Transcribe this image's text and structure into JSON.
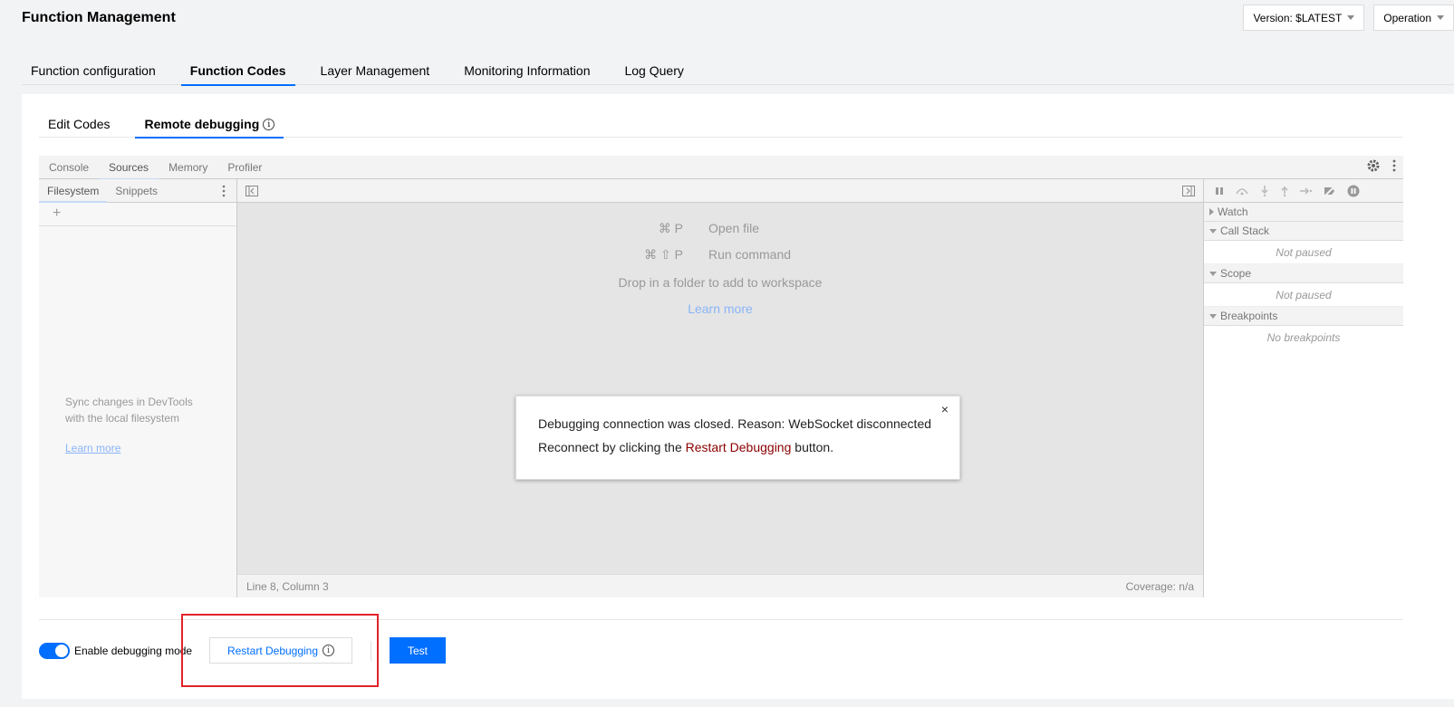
{
  "header": {
    "title": "Function Management",
    "version_label": "Version: $LATEST",
    "operation_label": "Operation"
  },
  "main_tabs": [
    {
      "label": "Function configuration"
    },
    {
      "label": "Function Codes",
      "active": true
    },
    {
      "label": "Layer Management"
    },
    {
      "label": "Monitoring Information"
    },
    {
      "label": "Log Query"
    }
  ],
  "sub_tabs": [
    {
      "label": "Edit Codes"
    },
    {
      "label": "Remote debugging",
      "active": true
    }
  ],
  "devtools": {
    "tabs": [
      "Console",
      "Sources",
      "Memory",
      "Profiler"
    ],
    "left_tabs": [
      "Filesystem",
      "Snippets"
    ],
    "plus": "+",
    "sync_msg": "Sync changes in DevTools with the local filesystem",
    "learn_more": "Learn more",
    "shortcuts": [
      {
        "key": "⌘ P",
        "action": "Open file"
      },
      {
        "key": "⌘ ⇧ P",
        "action": "Run command"
      }
    ],
    "drop_msg": "Drop in a folder to add to workspace",
    "learn_more_center": "Learn more",
    "status_left": "Line 8, Column 3",
    "status_right": "Coverage: n/a",
    "sections": {
      "watch": "Watch",
      "call_stack": "Call Stack",
      "call_stack_empty": "Not paused",
      "scope": "Scope",
      "scope_empty": "Not paused",
      "breakpoints": "Breakpoints",
      "breakpoints_empty": "No breakpoints"
    }
  },
  "dialog": {
    "close": "×",
    "line1": "Debugging connection was closed. Reason: WebSocket disconnected",
    "line2_pre": "Reconnect by clicking the ",
    "line2_link": "Restart Debugging",
    "line2_post": " button."
  },
  "footer": {
    "toggle_label": "Enable debugging mode",
    "restart_label": "Restart Debugging",
    "test_label": "Test"
  },
  "colors": {
    "accent": "#006eff",
    "highlight": "#e0232b"
  }
}
